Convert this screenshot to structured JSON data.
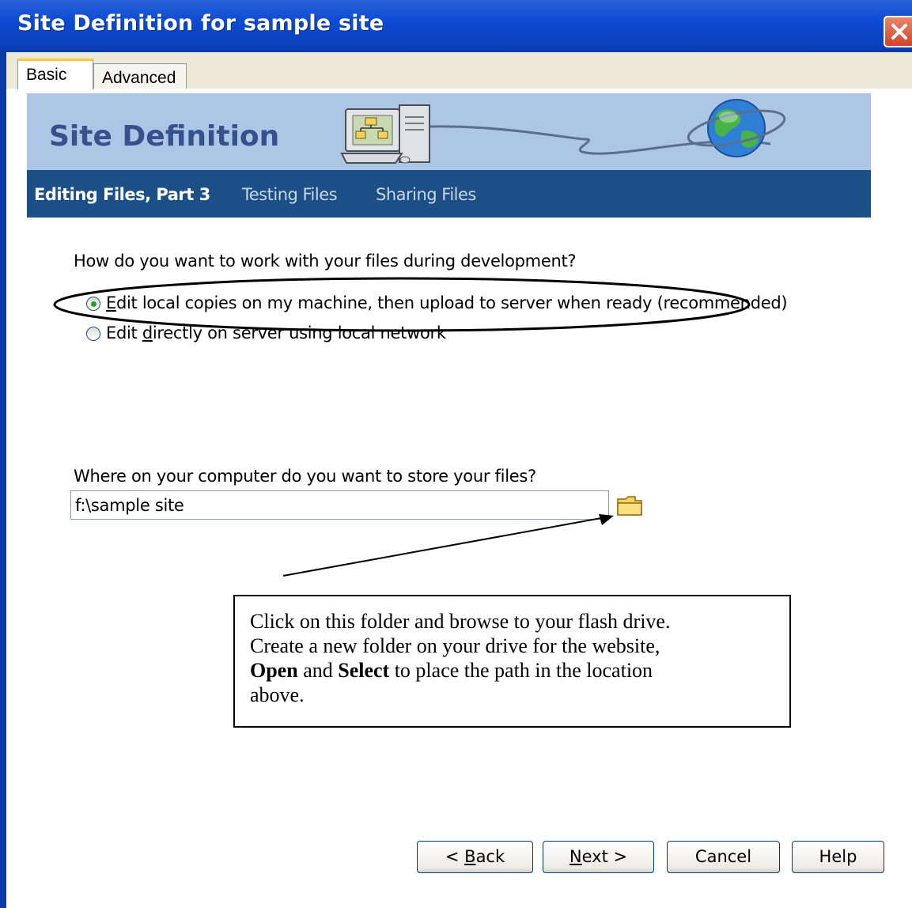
{
  "window": {
    "title": "Site Definition for sample site"
  },
  "tabs": [
    {
      "label": "Basic",
      "active": true
    },
    {
      "label": "Advanced",
      "active": false
    }
  ],
  "banner": {
    "title": "Site Definition"
  },
  "nav": [
    {
      "label": "Editing Files, Part 3",
      "active": true
    },
    {
      "label": "Testing Files",
      "active": false
    },
    {
      "label": "Sharing Files",
      "active": false
    }
  ],
  "question1": "How do you want to work with your files during development?",
  "options": [
    {
      "mnemonic": "E",
      "rest": "dit local copies on my machine, then upload to server when ready (recommended)",
      "selected": true
    },
    {
      "before": "Edit ",
      "mnemonic": "d",
      "rest": "irectly on server using local network",
      "selected": false
    }
  ],
  "question2": "Where on your computer do you want to store your files?",
  "path_field": {
    "value": "f:\\sample site"
  },
  "callout": {
    "line1": "Click on this folder and browse to your flash drive.",
    "line2": "Create a new folder on your drive for the website,",
    "open": "Open",
    "and": " and ",
    "select": "Select",
    "line3_rest": " to place the path in the location",
    "line4": "above."
  },
  "buttons": {
    "back": {
      "prefix": "< ",
      "mnemonic": "B",
      "rest": "ack"
    },
    "next": {
      "mnemonic": "N",
      "rest": "ext >"
    },
    "cancel": "Cancel",
    "help": "Help"
  },
  "colors": {
    "titlebar": "#0d4bd3",
    "banner": "#adc6e6",
    "navbar": "#1c4f86",
    "banner_title": "#36528c"
  },
  "icons": [
    "close-icon",
    "computer-icon",
    "globe-icon",
    "folder-icon"
  ]
}
